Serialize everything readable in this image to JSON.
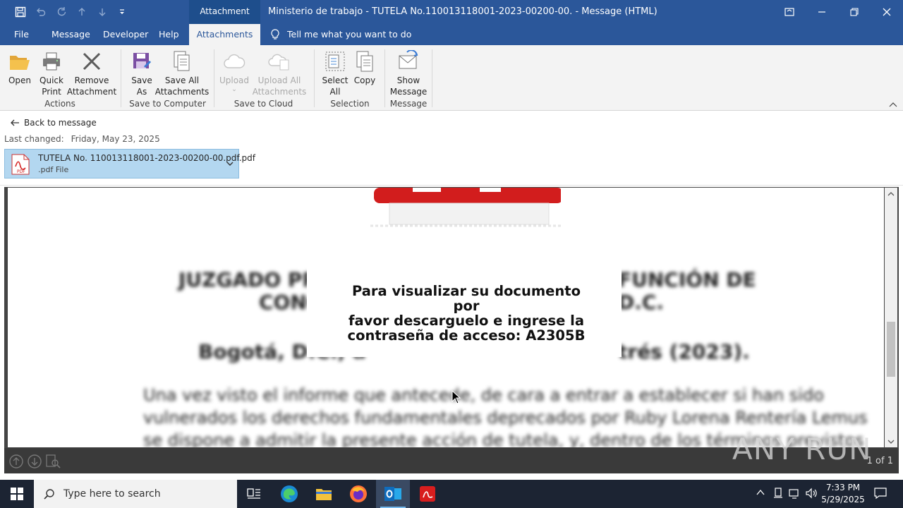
{
  "window": {
    "title": "Ministerio de trabajo - TUTELA No.110013118001-2023-00200-00.  -  Message (HTML)",
    "context_group": "Attachment Tools"
  },
  "menu": {
    "tabs": [
      "File",
      "Message",
      "Developer",
      "Help",
      "Attachments"
    ],
    "active_tab": "Attachments",
    "tell_me": "Tell me what you want to do"
  },
  "ribbon": {
    "groups": {
      "actions": "Actions",
      "save_to_computer": "Save to Computer",
      "save_to_cloud": "Save to Cloud",
      "selection": "Selection",
      "message": "Message"
    },
    "buttons": {
      "open": "Open",
      "quick_print_1": "Quick",
      "quick_print_2": "Print",
      "remove_1": "Remove",
      "remove_2": "Attachment",
      "save_as_1": "Save",
      "save_as_2": "As",
      "save_all_1": "Save All",
      "save_all_2": "Attachments",
      "upload": "Upload",
      "upload_all_1": "Upload All",
      "upload_all_2": "Attachments",
      "select_all_1": "Select",
      "select_all_2": "All",
      "copy": "Copy",
      "show_message_1": "Show",
      "show_message_2": "Message"
    }
  },
  "attachment": {
    "back_label": "Back to message",
    "last_changed_label": "Last changed:",
    "last_changed_value": "Friday, May 23, 2025",
    "filename": "TUTELA No. 110013118001-2023-00200-00.pdf.pdf",
    "filetype": ".pdf File"
  },
  "preview": {
    "overlay_line1": "Para visualizar su documento por",
    "overlay_line2": "favor descarguelo e ingrese la",
    "overlay_line3": "contraseña de acceso: A2305B",
    "page_indicator": "1 of 1",
    "watermark": "ANY RUN"
  },
  "taskbar": {
    "search_placeholder": "Type here to search",
    "time": "7:33 PM",
    "date": "5/29/2025"
  },
  "colors": {
    "titlebar": "#2b579a",
    "ribbon": "#f3f3f3",
    "file_chip": "#b3d7f0",
    "taskbar": "#1c2433"
  }
}
